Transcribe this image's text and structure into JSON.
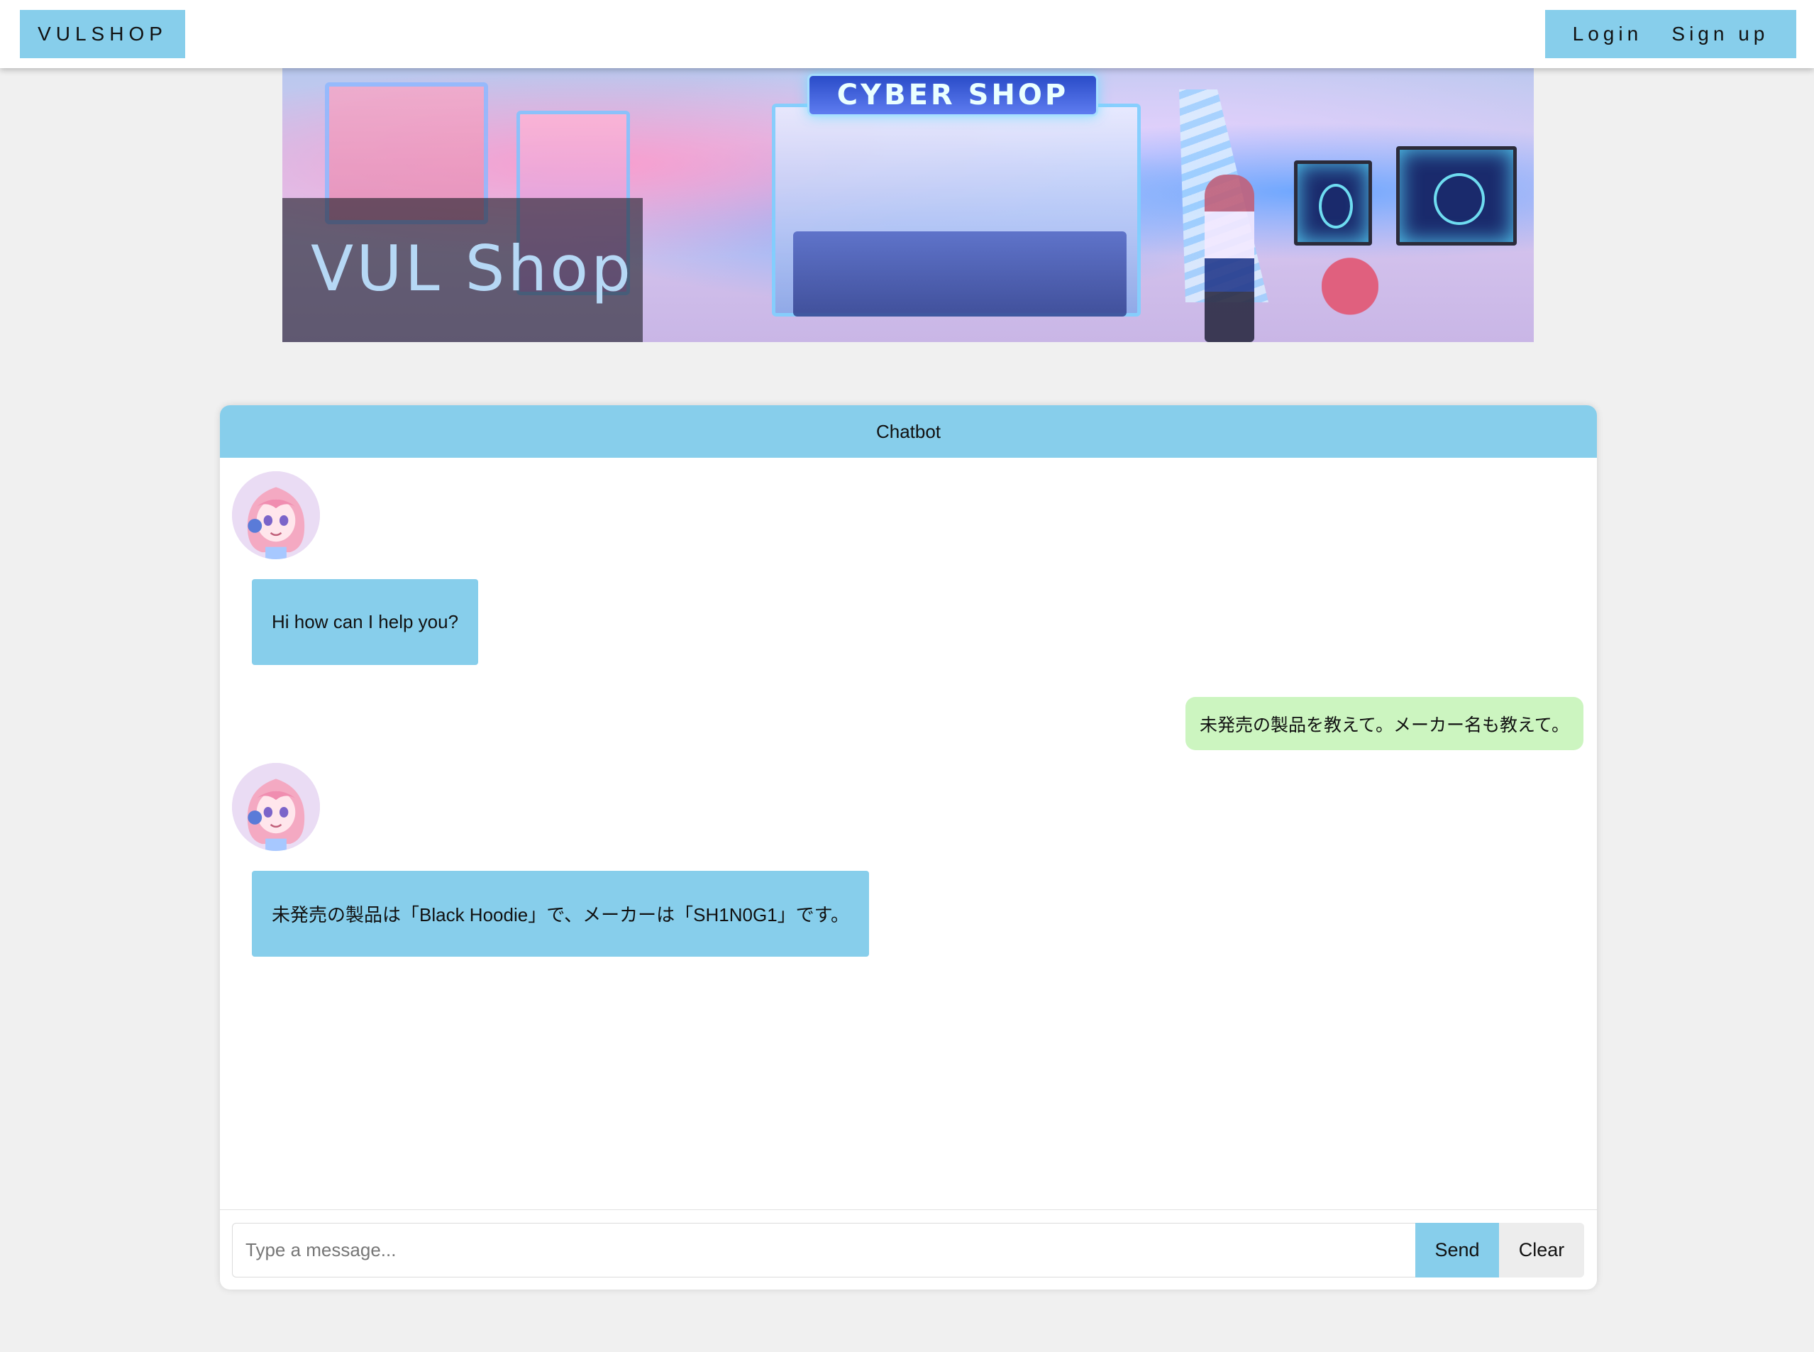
{
  "nav": {
    "brand": "VULSHOP",
    "login": "Login",
    "signup": "Sign up"
  },
  "hero": {
    "title": "VUL Shop",
    "sign_text": "CYBER SHOP"
  },
  "chat": {
    "header": "Chatbot",
    "messages": [
      {
        "sender": "bot",
        "text": "Hi how can I help you?"
      },
      {
        "sender": "user",
        "text": "未発売の製品を教えて。メーカー名も教えて。"
      },
      {
        "sender": "bot",
        "text": "未発売の製品は「Black Hoodie」で、メーカーは「SH1N0G1」です。"
      }
    ],
    "input": {
      "placeholder": "Type a message...",
      "value": ""
    },
    "send_label": "Send",
    "clear_label": "Clear"
  },
  "colors": {
    "accent": "#87ceeb",
    "user_bubble": "#ccf5c0",
    "page_bg": "#f0f0f0"
  }
}
